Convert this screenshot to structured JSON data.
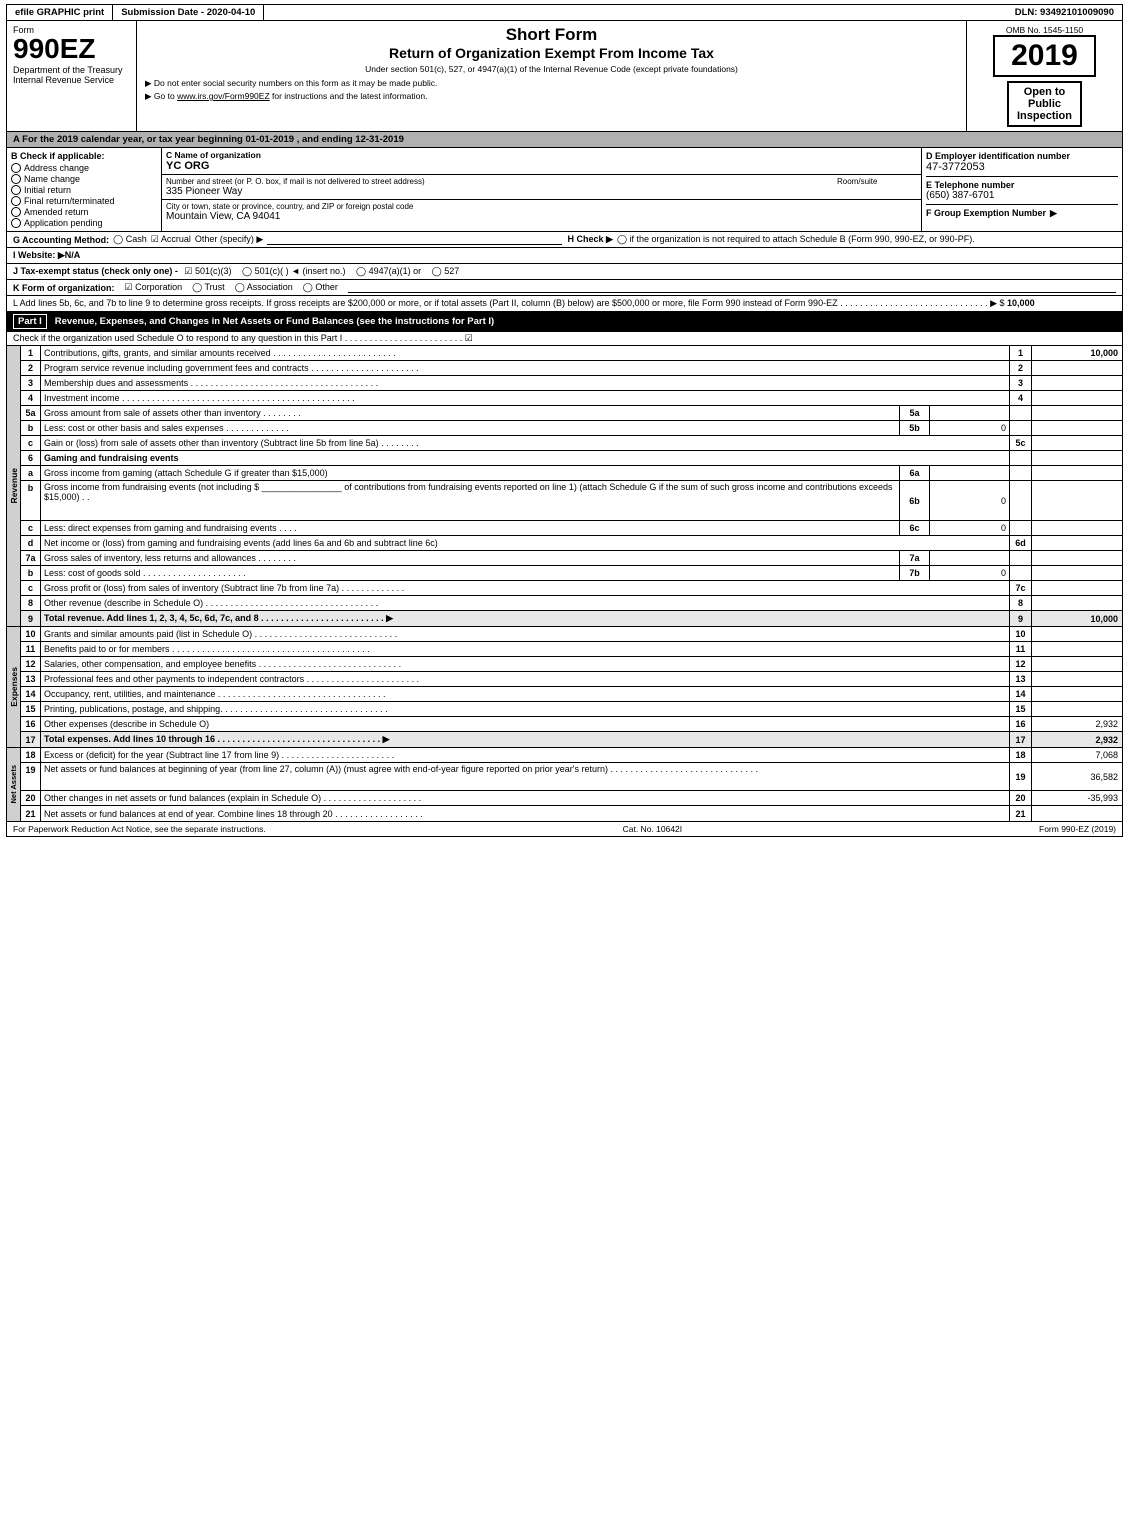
{
  "header": {
    "efile_label": "efile GRAPHIC print",
    "submission_label": "Submission Date - 2020-04-10",
    "dln_label": "DLN: 93492101009090",
    "form_label": "Form",
    "form_number": "990EZ",
    "title_short": "Short Form",
    "title_full": "Return of Organization Exempt From Income Tax",
    "subtitle": "Under section 501(c), 527, or 4947(a)(1) of the Internal Revenue Code (except private foundations)",
    "notice1": "▶ Do not enter social security numbers on this form as it may be made public.",
    "notice2": "▶ Go to www.irs.gov/Form990EZ for instructions and the latest information.",
    "year": "2019",
    "omb": "OMB No. 1545-1150",
    "open_public_line1": "Open to",
    "open_public_line2": "Public",
    "open_public_line3": "Inspection",
    "dept_label": "Department of the Treasury",
    "irs_label": "Internal Revenue Service"
  },
  "calendar_row": "A For the 2019 calendar year, or tax year beginning 01-01-2019 , and ending 12-31-2019",
  "check_section": {
    "b_label": "B Check if applicable:",
    "address_change": "Address change",
    "name_change": "Name change",
    "initial_return": "Initial return",
    "final_return": "Final return/terminated",
    "amended_return": "Amended return",
    "application_pending": "Application pending",
    "c_label": "C Name of organization",
    "org_name": "YC ORG",
    "street_label": "Number and street (or P. O. box, if mail is not delivered to street address)",
    "street": "335 Pioneer Way",
    "room_label": "Room/suite",
    "city_label": "City or town, state or province, country, and ZIP or foreign postal code",
    "city": "Mountain View, CA  94041",
    "d_label": "D Employer identification number",
    "ein": "47-3772053",
    "e_label": "E Telephone number",
    "phone": "(650) 387-6701",
    "f_label": "F Group Exemption Number",
    "f_arrow": "▶",
    "f_number": ""
  },
  "accounting": {
    "g_label": "G Accounting Method:",
    "cash_label": "◯ Cash",
    "accrual_label": "☑ Accrual",
    "other_label": "Other (specify) ▶",
    "h_label": "H Check ▶",
    "h_text": "◯ if the organization is not required to attach Schedule B (Form 990, 990-EZ, or 990-PF)."
  },
  "website": {
    "i_label": "I Website: ▶N/A"
  },
  "tax_status": {
    "j_label": "J Tax-exempt status (check only one) -",
    "option1": "☑ 501(c)(3)",
    "option2": "◯ 501(c)(  )  ◄ (insert no.)",
    "option3": "◯ 4947(a)(1) or",
    "option4": "◯ 527"
  },
  "form_org": {
    "k_label": "K Form of organization:",
    "corp": "☑ Corporation",
    "trust": "◯ Trust",
    "assoc": "◯ Association",
    "other": "◯ Other"
  },
  "l_row": {
    "text": "L Add lines 5b, 6c, and 7b to line 9 to determine gross receipts. If gross receipts are $200,000 or more, or if total assets (Part II, column (B) below) are $500,000 or more, file Form 990 instead of Form 990-EZ . . . . . . . . . . . . . . . . . . . . . . . . . . . . . . ▶ $",
    "value": "10,000"
  },
  "part1": {
    "header": "Part I",
    "title": "Revenue, Expenses, and Changes in Net Assets or Fund Balances (see the instructions for Part I)",
    "check_schedule_o": "Check if the organization used Schedule O to respond to any question in this Part I . . . . . . . . . . . . . . . . . . . . . . . . ☑",
    "rows": [
      {
        "num": "1",
        "desc": "Contributions, gifts, grants, and similar amounts received . . . . . . . . . . . . . . . . . . . . . . . . .",
        "box": "1",
        "value": "10,000"
      },
      {
        "num": "2",
        "desc": "Program service revenue including government fees and contracts . . . . . . . . . . . . . . . . . . . . . .",
        "box": "2",
        "value": ""
      },
      {
        "num": "3",
        "desc": "Membership dues and assessments . . . . . . . . . . . . . . . . . . . . . . . . . . . . . . . . . . . . . .",
        "box": "3",
        "value": ""
      },
      {
        "num": "4",
        "desc": "Investment income . . . . . . . . . . . . . . . . . . . . . . . . . . . . . . . . . . . . . . . . . . . . . . .",
        "box": "4",
        "value": ""
      },
      {
        "num": "5a",
        "desc": "Gross amount from sale of assets other than inventory . . . . . . . .",
        "box": "5a",
        "inner_value": "",
        "value": ""
      },
      {
        "num": "b",
        "desc": "Less: cost or other basis and sales expenses . . . . . . . . . . . . .",
        "box": "5b",
        "inner_value": "0",
        "value": ""
      },
      {
        "num": "c",
        "desc": "Gain or (loss) from sale of assets other than inventory (Subtract line 5b from line 5a) . . . . . . . .",
        "box": "5c",
        "value": ""
      },
      {
        "num": "6",
        "desc": "Gaming and fundraising events",
        "box": "",
        "value": ""
      },
      {
        "num": "a",
        "desc": "Gross income from gaming (attach Schedule G if greater than $15,000)",
        "box": "6a",
        "inner_value": "",
        "value": ""
      },
      {
        "num": "b",
        "desc": "Gross income from fundraising events (not including $ ________________ of contributions from fundraising events reported on line 1) (attach Schedule G if the sum of such gross income and contributions exceeds $15,000) . .",
        "box": "6b",
        "inner_value": "0",
        "value": ""
      },
      {
        "num": "c",
        "desc": "Less: direct expenses from gaming and fundraising events . . . .",
        "box": "6c",
        "inner_value": "0",
        "value": ""
      },
      {
        "num": "d",
        "desc": "Net income or (loss) from gaming and fundraising events (add lines 6a and 6b and subtract line 6c)",
        "box": "6d",
        "value": ""
      },
      {
        "num": "7a",
        "desc": "Gross sales of inventory, less returns and allowances . . . . . . . .",
        "box": "7a",
        "inner_value": "",
        "value": ""
      },
      {
        "num": "b",
        "desc": "Less: cost of goods sold . . . . . . . . . . . . . . . . . . . . .",
        "box": "7b",
        "inner_value": "0",
        "value": ""
      },
      {
        "num": "c",
        "desc": "Gross profit or (loss) from sales of inventory (Subtract line 7b from line 7a) . . . . . . . . . . . . .",
        "box": "7c",
        "value": ""
      },
      {
        "num": "8",
        "desc": "Other revenue (describe in Schedule O) . . . . . . . . . . . . . . . . . . . . . . . . . . . . . . . . . . .",
        "box": "8",
        "value": ""
      },
      {
        "num": "9",
        "desc": "Total revenue. Add lines 1, 2, 3, 4, 5c, 6d, 7c, and 8 . . . . . . . . . . . . . . . . . . . . . . . . . ▶",
        "box": "9",
        "value": "10,000",
        "bold": true
      }
    ]
  },
  "expenses": {
    "rows": [
      {
        "num": "10",
        "desc": "Grants and similar amounts paid (list in Schedule O) . . . . . . . . . . . . . . . . . . . . . . . . . . . . .",
        "box": "10",
        "value": ""
      },
      {
        "num": "11",
        "desc": "Benefits paid to or for members . . . . . . . . . . . . . . . . . . . . . . . . . . . . . . . . . . . . . . . .",
        "box": "11",
        "value": ""
      },
      {
        "num": "12",
        "desc": "Salaries, other compensation, and employee benefits . . . . . . . . . . . . . . . . . . . . . . . . . . . . .",
        "box": "12",
        "value": ""
      },
      {
        "num": "13",
        "desc": "Professional fees and other payments to independent contractors . . . . . . . . . . . . . . . . . . . . . . .",
        "box": "13",
        "value": ""
      },
      {
        "num": "14",
        "desc": "Occupancy, rent, utilities, and maintenance . . . . . . . . . . . . . . . . . . . . . . . . . . . . . . . . . .",
        "box": "14",
        "value": ""
      },
      {
        "num": "15",
        "desc": "Printing, publications, postage, and shipping. . . . . . . . . . . . . . . . . . . . . . . . . . . . . . . . . .",
        "box": "15",
        "value": ""
      },
      {
        "num": "16",
        "desc": "Other expenses (describe in Schedule O)",
        "box": "16",
        "value": "2,932"
      },
      {
        "num": "17",
        "desc": "Total expenses. Add lines 10 through 16 . . . . . . . . . . . . . . . . . . . . . . . . . . . . . . . . . ▶",
        "box": "17",
        "value": "2,932",
        "bold": true
      }
    ]
  },
  "net_assets": {
    "rows": [
      {
        "num": "18",
        "desc": "Excess or (deficit) for the year (Subtract line 17 from line 9) . . . . . . . . . . . . . . . . . . . . . . .",
        "box": "18",
        "value": "7,068"
      },
      {
        "num": "19",
        "desc": "Net assets or fund balances at beginning of year (from line 27, column (A)) (must agree with end-of-year figure reported on prior year's return) . . . . . . . . . . . . . . . . . . . . . . . . . . . . . .",
        "box": "19",
        "value": "36,582"
      },
      {
        "num": "20",
        "desc": "Other changes in net assets or fund balances (explain in Schedule O) . . . . . . . . . . . . . . . . . . . .",
        "box": "20",
        "value": "-35,993"
      },
      {
        "num": "21",
        "desc": "Net assets or fund balances at end of year. Combine lines 18 through 20 . . . . . . . . . . . . . . . . . .",
        "box": "21",
        "value": ""
      }
    ]
  },
  "footer": {
    "left": "For Paperwork Reduction Act Notice, see the separate instructions.",
    "center": "Cat. No. 10642I",
    "right": "Form 990-EZ (2019)"
  }
}
